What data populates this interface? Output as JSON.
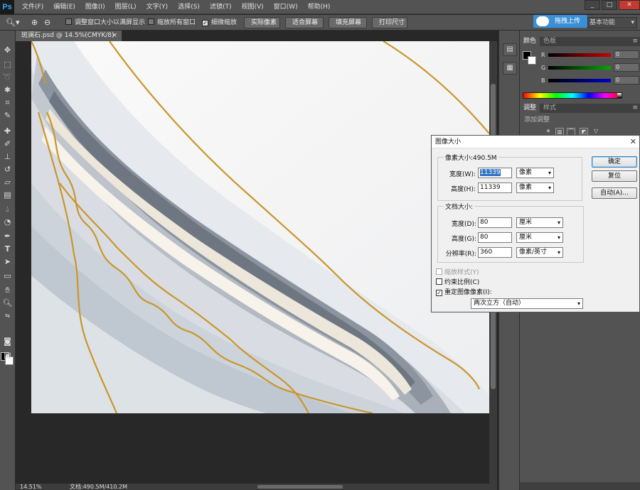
{
  "app": {
    "logo": "Ps"
  },
  "menu": [
    "文件(F)",
    "编辑(E)",
    "图像(I)",
    "图层(L)",
    "文字(Y)",
    "选择(S)",
    "滤镜(T)",
    "视图(V)",
    "窗口(W)",
    "帮助(H)"
  ],
  "window_buttons": {
    "minimize": "_",
    "restore": "□",
    "close": "✕"
  },
  "options_bar": {
    "resize_windows_label": "调整窗口大小以满屏显示",
    "zoom_all_label": "缩放所有窗口",
    "scrubby_zoom_label": "细微缩放",
    "actual_pixels": "实际像素",
    "fit_screen": "适合屏幕",
    "fill_screen": "填充屏幕",
    "print_size": "打印尺寸",
    "cloud_button": "拖拽上传",
    "workspace": "基本功能"
  },
  "document": {
    "tab_title": "斑澜石.psd @ 14.5%(CMYK/8)",
    "tab_close": "×",
    "status_zoom": "14.51%",
    "status_doc": "文档:490.5M/410.2M"
  },
  "panels": {
    "color_tab": "颜色",
    "swatches_tab": "色板",
    "adjust_tab": "调整",
    "styles_tab": "样式",
    "adjust_title": "添加调整",
    "sliders": [
      {
        "label": "R",
        "value": "0",
        "color": "#cc0000"
      },
      {
        "label": "G",
        "value": "0",
        "color": "#00aa00"
      },
      {
        "label": "B",
        "value": "0",
        "color": "#0000cc"
      }
    ]
  },
  "dialog": {
    "title": "图像大小",
    "close": "✕",
    "pixel_dimensions_label": "像素大小:490.5M",
    "width_label": "宽度(W):",
    "width_value": "11339",
    "width_unit": "像素",
    "height_label": "高度(H):",
    "height_value": "11339",
    "height_unit": "像素",
    "doc_size_label": "文档大小:",
    "doc_width_label": "宽度(D):",
    "doc_width_value": "80",
    "doc_width_unit": "厘米",
    "doc_height_label": "高度(G):",
    "doc_height_value": "80",
    "doc_height_unit": "厘米",
    "resolution_label": "分辨率(R):",
    "resolution_value": "360",
    "resolution_unit": "像素/英寸",
    "scale_styles_label": "缩放样式(Y)",
    "constrain_label": "约束比例(C)",
    "resample_label": "重定图像像素(I):",
    "resample_method": "两次立方（自动）",
    "ok_button": "确定",
    "reset_button": "复位",
    "auto_button": "自动(A)..."
  },
  "colors": {
    "accent": "#3b8fd6",
    "gold_vein": "#c9962a"
  }
}
